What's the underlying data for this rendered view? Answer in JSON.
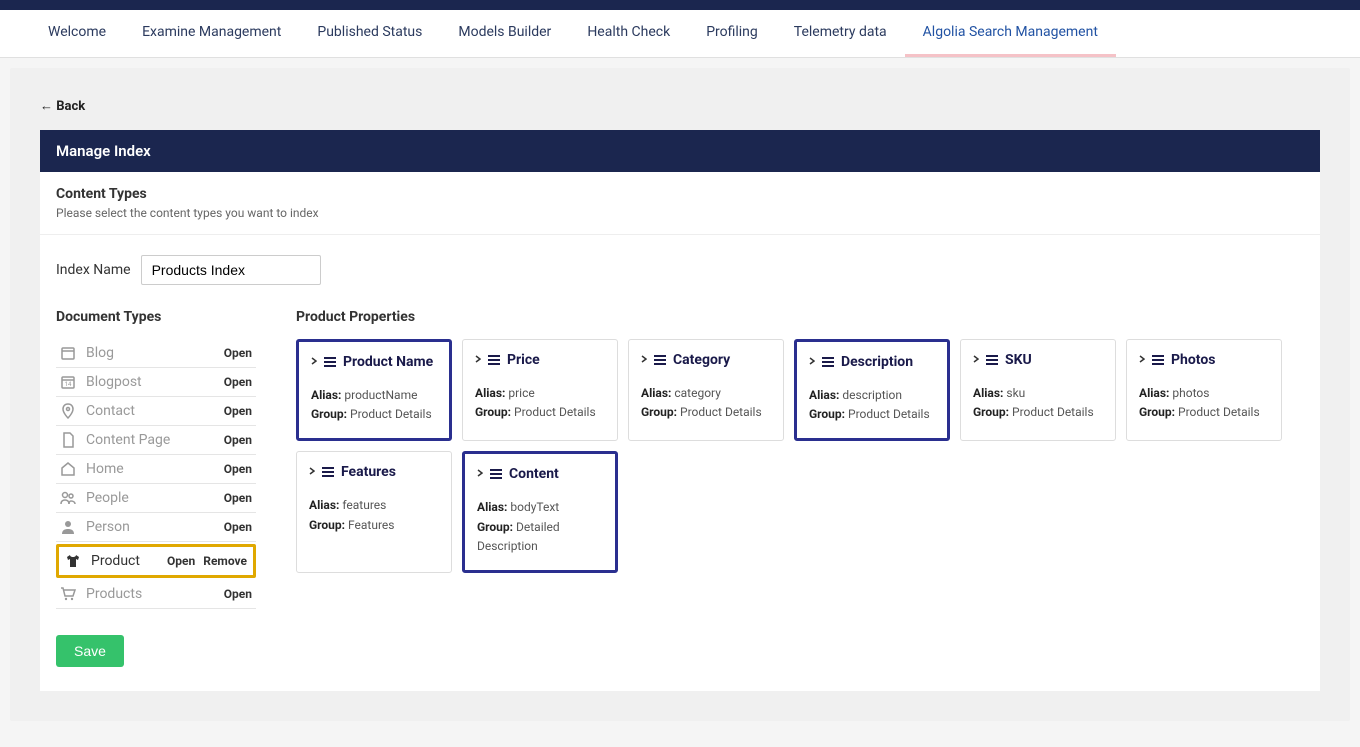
{
  "tabs": [
    "Welcome",
    "Examine Management",
    "Published Status",
    "Models Builder",
    "Health Check",
    "Profiling",
    "Telemetry data",
    "Algolia Search Management"
  ],
  "active_tab": 7,
  "back_label": "← Back",
  "header_title": "Manage Index",
  "section": {
    "title": "Content Types",
    "sub": "Please select the content types you want to index"
  },
  "index_name_label": "Index Name",
  "index_name_value": "Products Index",
  "doc_types_heading": "Document Types",
  "properties_heading": "Product Properties",
  "open_label": "Open",
  "remove_label": "Remove",
  "save_label": "Save",
  "alias_label": "Alias:",
  "group_label": "Group:",
  "doc_types": [
    {
      "icon": "calendar",
      "label": "Blog",
      "highlighted": false,
      "removable": false
    },
    {
      "icon": "calendar-num",
      "label": "Blogpost",
      "highlighted": false,
      "removable": false
    },
    {
      "icon": "pin",
      "label": "Contact",
      "highlighted": false,
      "removable": false
    },
    {
      "icon": "file",
      "label": "Content Page",
      "highlighted": false,
      "removable": false
    },
    {
      "icon": "home",
      "label": "Home",
      "highlighted": false,
      "removable": false
    },
    {
      "icon": "people",
      "label": "People",
      "highlighted": false,
      "removable": false
    },
    {
      "icon": "person",
      "label": "Person",
      "highlighted": false,
      "removable": false
    },
    {
      "icon": "shirt",
      "label": "Product",
      "highlighted": true,
      "removable": true
    },
    {
      "icon": "cart",
      "label": "Products",
      "highlighted": false,
      "removable": false
    }
  ],
  "properties": [
    {
      "title": "Product Name",
      "alias": "productName",
      "group": "Product Details",
      "selected": true
    },
    {
      "title": "Price",
      "alias": "price",
      "group": "Product Details",
      "selected": false
    },
    {
      "title": "Category",
      "alias": "category",
      "group": "Product Details",
      "selected": false
    },
    {
      "title": "Description",
      "alias": "description",
      "group": "Product Details",
      "selected": true
    },
    {
      "title": "SKU",
      "alias": "sku",
      "group": "Product Details",
      "selected": false
    },
    {
      "title": "Photos",
      "alias": "photos",
      "group": "Product Details",
      "selected": false
    },
    {
      "title": "Features",
      "alias": "features",
      "group": "Features",
      "selected": false
    },
    {
      "title": "Content",
      "alias": "bodyText",
      "group": "Detailed Description",
      "selected": true
    }
  ]
}
